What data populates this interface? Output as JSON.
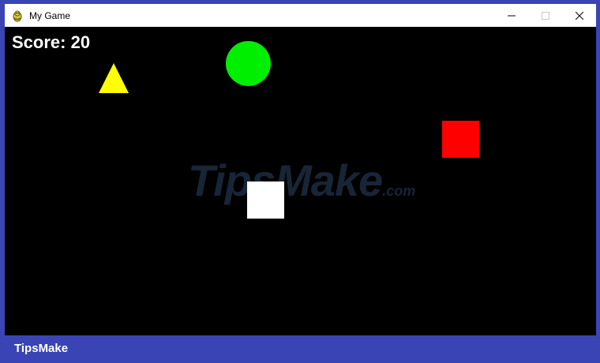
{
  "window": {
    "title": "My Game",
    "icon": "pygame-snake-icon",
    "controls": [
      "minimize-icon",
      "maximize-icon",
      "close-icon"
    ]
  },
  "game": {
    "score_text": "Score: 20",
    "colors": {
      "background": "#000000",
      "circle": "#00ee00",
      "triangle": "#ffff00",
      "red_square": "#ff0000",
      "white_square": "#ffffff"
    }
  },
  "watermark": {
    "main": "TipsMake",
    "suffix": ".com"
  },
  "footer": {
    "brand": "TipsMake"
  }
}
